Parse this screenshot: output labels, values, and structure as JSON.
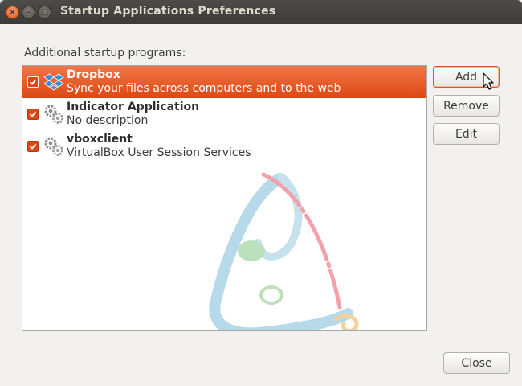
{
  "window": {
    "title": "Startup Applications Preferences",
    "controls": {
      "close_glyph": "×",
      "minimize_glyph": "–",
      "maximize_glyph": "□"
    }
  },
  "section_label": "Additional startup programs:",
  "programs": [
    {
      "name": "Dropbox",
      "description": "Sync your files across computers and to the web",
      "checked": true,
      "icon": "dropbox-icon",
      "selected": true
    },
    {
      "name": "Indicator Application",
      "description": "No description",
      "checked": true,
      "icon": "gears-icon",
      "selected": false
    },
    {
      "name": "vboxclient",
      "description": "VirtualBox User Session Services",
      "checked": true,
      "icon": "gears-icon",
      "selected": false
    }
  ],
  "buttons": {
    "add": "Add",
    "remove": "Remove",
    "edit": "Edit",
    "close": "Close"
  },
  "colors": {
    "selection": "#dd4814",
    "checkbox": "#dd4814",
    "titlebar": "#3c3b37",
    "window_bg": "#f2f1f0"
  }
}
